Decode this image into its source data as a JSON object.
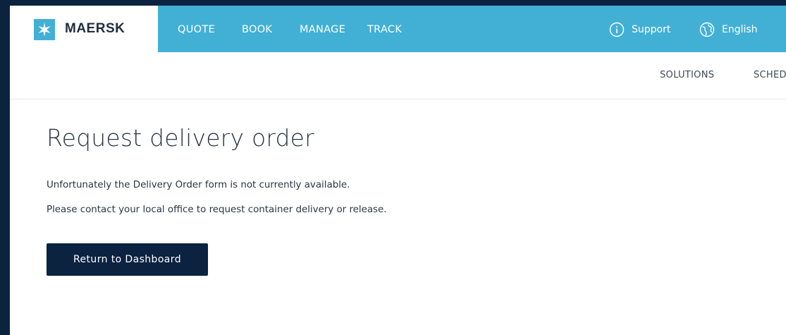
{
  "header": {
    "brand": "MAERSK",
    "logo_icon": "star-icon",
    "nav": [
      {
        "label": "QUOTE"
      },
      {
        "label": "BOOK"
      },
      {
        "label": "MANAGE"
      },
      {
        "label": "TRACK"
      }
    ],
    "support": {
      "label": "Support",
      "icon": "info-icon"
    },
    "language": {
      "label": "English",
      "icon": "globe-icon"
    },
    "subnav": [
      {
        "label": "SOLUTIONS"
      },
      {
        "label": "SCHED"
      }
    ]
  },
  "main": {
    "title": "Request delivery order",
    "messages": [
      "Unfortunately the Delivery Order form is not currently available.",
      "Please contact your local office to request container delivery or release."
    ],
    "button_label": "Return to Dashboard"
  },
  "colors": {
    "brand_blue": "#42b0d5",
    "navy": "#0b2240",
    "frame": "#0c2340"
  }
}
